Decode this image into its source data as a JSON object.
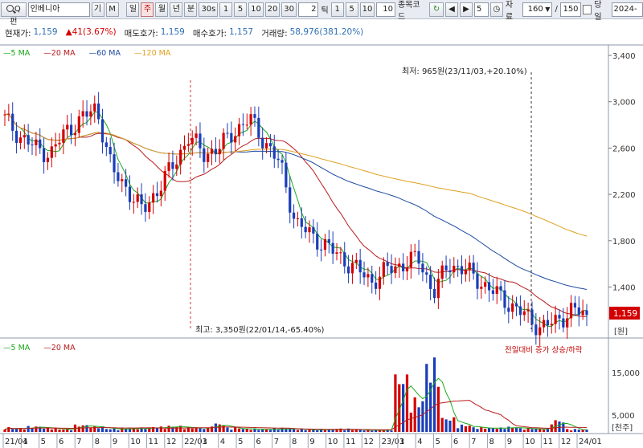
{
  "toolbar": {
    "search_label": "Q펀",
    "stock_name": "인베니아",
    "btn_ki": "기",
    "btn_m": "M",
    "periods": [
      "일",
      "주",
      "월",
      "년",
      "분",
      "30s",
      "1",
      "5",
      "10",
      "20",
      "30"
    ],
    "active_period": "주",
    "tick_input": "2",
    "tick_label": "틱",
    "tick_options": [
      "1",
      "5",
      "10"
    ],
    "tick_value": "10",
    "code_label": "종목코드",
    "step_value": "5",
    "data_label": "자료",
    "data_count": "160",
    "slash": "/",
    "total_count": "150",
    "today_label": "당일",
    "date_value": "2024-0"
  },
  "status": {
    "current_price_label": "현재가:",
    "current_price": "1,159",
    "change": "41(3.67%)",
    "ask_label": "매도호가:",
    "ask": "1,159",
    "bid_label": "매수호가:",
    "bid": "1,157",
    "volume_label": "거래량:",
    "volume": "58,976(381.20%)"
  },
  "price_legend": [
    {
      "label": "5 MA",
      "color": "#1aa81a"
    },
    {
      "label": "20 MA",
      "color": "#b81c1c"
    },
    {
      "label": "60 MA",
      "color": "#1d4aa0"
    },
    {
      "label": "120 MA",
      "color": "#e0a020"
    }
  ],
  "volume_legend": [
    {
      "label": "5 MA",
      "color": "#1aa81a"
    },
    {
      "label": "20 MA",
      "color": "#b81c1c"
    }
  ],
  "volume_note": "전일대비 증가 상승/하락",
  "annotations": {
    "low": "최저: 965원(23/11/03,+20.10%)",
    "high": "최고: 3,350원(22/01/14,-65.40%)"
  },
  "price_axis": {
    "ticks": [
      "3,400",
      "3,000",
      "2,600",
      "2,200",
      "1,800",
      "1,400"
    ],
    "current_tag": "1,159",
    "unit": "[원]",
    "current_color": "#d20000"
  },
  "volume_axis": {
    "ticks": [
      "15,000",
      "5,000"
    ],
    "unit": "[천주]"
  },
  "x_axis": [
    "21/01",
    "4",
    "5",
    "6",
    "7",
    "8",
    "9",
    "10",
    "11",
    "12",
    "22/01",
    "3",
    "4",
    "5",
    "6",
    "7",
    "8",
    "9",
    "10",
    "11",
    "12",
    "23/01",
    "3",
    "4",
    "5",
    "6",
    "7",
    "8",
    "9",
    "10",
    "11",
    "12",
    "24/01"
  ],
  "chart_data": {
    "type": "candlestick",
    "interval": "weekly",
    "ylim": [
      965,
      3400
    ],
    "volume_ylim": [
      0,
      19000
    ],
    "key_points": [
      {
        "label": "low",
        "value": 965,
        "date": "23/11/03"
      },
      {
        "label": "high",
        "value": 3350,
        "date": "22/01/14"
      }
    ],
    "current": 1159,
    "close_trend": [
      2850,
      2700,
      2600,
      2550,
      2750,
      2850,
      2950,
      2400,
      2250,
      2050,
      2250,
      2450,
      2700,
      2550,
      2600,
      2750,
      2850,
      2650,
      2450,
      1950,
      1850,
      1750,
      1650,
      1550,
      1450,
      1550,
      1600,
      1650,
      1350,
      1600,
      1550,
      1450,
      1350,
      1250,
      1150,
      1050,
      1100,
      1200,
      1159
    ],
    "volume_trend": [
      1000,
      800,
      1200,
      900,
      600,
      1500,
      1200,
      700,
      800,
      900,
      1100,
      1300,
      1000,
      900,
      1800,
      900,
      700,
      600,
      800,
      700,
      500,
      600,
      700,
      500,
      400,
      500,
      12000,
      7000,
      15000,
      3000,
      1500,
      1000,
      900,
      1100,
      800,
      700,
      2500,
      600,
      500
    ]
  }
}
